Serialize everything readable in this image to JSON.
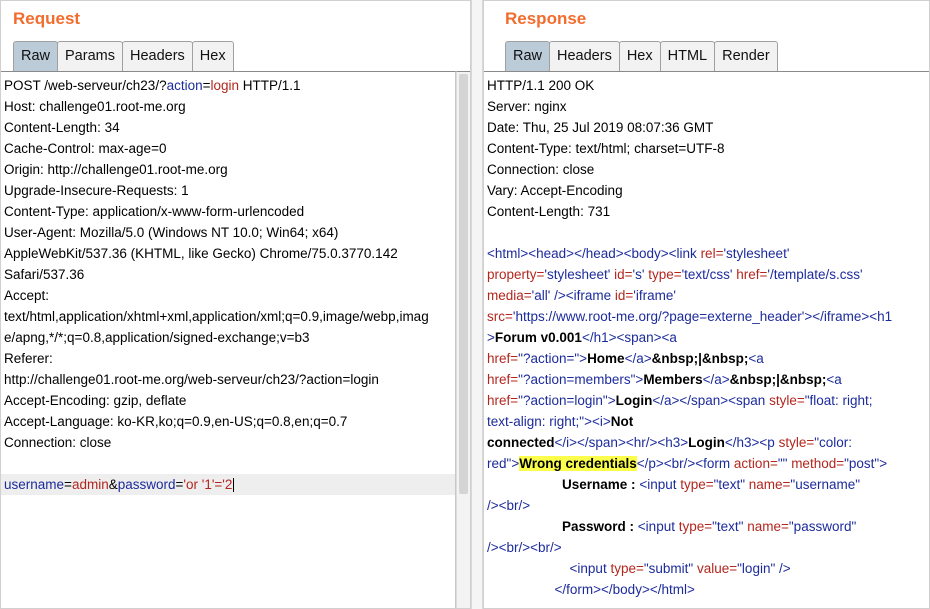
{
  "request": {
    "title": "Request",
    "tabs": [
      "Raw",
      "Params",
      "Headers",
      "Hex"
    ],
    "active_tab": "Raw",
    "request_line": {
      "method_path": "POST /web-serveur/ch23/?",
      "param": "action",
      "eq": "=",
      "value": "login",
      "version": " HTTP/1.1"
    },
    "headers": [
      "Host: challenge01.root-me.org",
      "Content-Length: 34",
      "Cache-Control: max-age=0",
      "Origin: http://challenge01.root-me.org",
      "Upgrade-Insecure-Requests: 1",
      "Content-Type: application/x-www-form-urlencoded",
      "User-Agent: Mozilla/5.0 (Windows NT 10.0; Win64; x64)",
      "AppleWebKit/537.36 (KHTML, like Gecko) Chrome/75.0.3770.142",
      "Safari/537.36",
      "Accept:",
      "text/html,application/xhtml+xml,application/xml;q=0.9,image/webp,imag",
      "e/apng,*/*;q=0.8,application/signed-exchange;v=b3",
      "Referer:",
      "http://challenge01.root-me.org/web-serveur/ch23/?action=login",
      "Accept-Encoding: gzip, deflate",
      "Accept-Language: ko-KR,ko;q=0.9,en-US;q=0.8,en;q=0.7",
      "Connection: close"
    ],
    "body": {
      "k1": "username",
      "v1": "admin",
      "amp": "&",
      "k2": "password",
      "v2": "'or '1'='2"
    }
  },
  "response": {
    "title": "Response",
    "tabs": [
      "Raw",
      "Headers",
      "Hex",
      "HTML",
      "Render"
    ],
    "active_tab": "Raw",
    "headers": [
      "HTTP/1.1 200 OK",
      "Server: nginx",
      "Date: Thu, 25 Jul 2019 08:07:36 GMT",
      "Content-Type: text/html; charset=UTF-8",
      "Connection: close",
      "Vary: Accept-Encoding",
      "Content-Length: 731"
    ],
    "body_lines": [
      [
        [
          "b",
          "<html><head></head><body><link "
        ],
        [
          "r",
          "rel="
        ],
        [
          "b",
          "'stylesheet'"
        ]
      ],
      [
        [
          "r",
          "property="
        ],
        [
          "b",
          "'stylesheet' "
        ],
        [
          "r",
          "id="
        ],
        [
          "b",
          "'s' "
        ],
        [
          "r",
          "type="
        ],
        [
          "b",
          "'text/css' "
        ],
        [
          "r",
          "href="
        ],
        [
          "b",
          "'/template/s.css'"
        ]
      ],
      [
        [
          "r",
          "media="
        ],
        [
          "b",
          "'all' "
        ],
        [
          "b",
          "/><iframe "
        ],
        [
          "r",
          "id="
        ],
        [
          "b",
          "'iframe'"
        ]
      ],
      [
        [
          "r",
          "src="
        ],
        [
          "b",
          "'https://www.root-me.org/?page=externe_header'"
        ],
        [
          "b",
          "></iframe><h1"
        ]
      ],
      [
        [
          "b",
          ">"
        ],
        [
          "kb",
          "Forum v0.001"
        ],
        [
          "b",
          "</h1><span><a"
        ]
      ],
      [
        [
          "r",
          "href="
        ],
        [
          "b",
          "\"?action=\""
        ],
        [
          "b",
          ">"
        ],
        [
          "kb",
          "Home"
        ],
        [
          "b",
          "</a>"
        ],
        [
          "kb",
          "&nbsp;|&nbsp;"
        ],
        [
          "b",
          "<a"
        ]
      ],
      [
        [
          "r",
          "href="
        ],
        [
          "b",
          "\"?action=members\""
        ],
        [
          "b",
          ">"
        ],
        [
          "kb",
          "Members"
        ],
        [
          "b",
          "</a>"
        ],
        [
          "kb",
          "&nbsp;|&nbsp;"
        ],
        [
          "b",
          "<a"
        ]
      ],
      [
        [
          "r",
          "href="
        ],
        [
          "b",
          "\"?action=login\""
        ],
        [
          "b",
          ">"
        ],
        [
          "kb",
          "Login"
        ],
        [
          "b",
          "</a></span><span "
        ],
        [
          "r",
          "style="
        ],
        [
          "b",
          "\"float: right;"
        ]
      ],
      [
        [
          "b",
          "text-align: right;\""
        ],
        [
          "b",
          "><i>"
        ],
        [
          "kb",
          "Not"
        ]
      ],
      [
        [
          "kb",
          "connected"
        ],
        [
          "b",
          "</i></span><hr/><h3>"
        ],
        [
          "kb",
          "Login"
        ],
        [
          "b",
          "</h3><p "
        ],
        [
          "r",
          "style="
        ],
        [
          "b",
          "\"color:"
        ]
      ],
      [
        [
          "b",
          "red\""
        ],
        [
          "hl",
          ">Wrong credentials"
        ],
        [
          "b",
          "</p><br/><form "
        ],
        [
          "r",
          "action="
        ],
        [
          "b",
          "\"\" "
        ],
        [
          "r",
          "method="
        ],
        [
          "b",
          "\"post\">"
        ]
      ],
      [
        [
          "sp",
          "                    "
        ],
        [
          "kb",
          "Username : "
        ],
        [
          "b",
          "<input "
        ],
        [
          "r",
          "type="
        ],
        [
          "b",
          "\"text\" "
        ],
        [
          "r",
          "name="
        ],
        [
          "b",
          "\"username\""
        ]
      ],
      [
        [
          "b",
          "/><br/>"
        ]
      ],
      [
        [
          "sp",
          "                    "
        ],
        [
          "kb",
          "Password : "
        ],
        [
          "b",
          "<input "
        ],
        [
          "r",
          "type="
        ],
        [
          "b",
          "\"text\" "
        ],
        [
          "r",
          "name="
        ],
        [
          "b",
          "\"password\""
        ]
      ],
      [
        [
          "b",
          "/><br/><br/>"
        ]
      ],
      [
        [
          "sp",
          "                      "
        ],
        [
          "b",
          "<input "
        ],
        [
          "r",
          "type="
        ],
        [
          "b",
          "\"submit\" "
        ],
        [
          "r",
          "value="
        ],
        [
          "b",
          "\"login\" />"
        ]
      ],
      [
        [
          "sp",
          "                  "
        ],
        [
          "b",
          "</form></body></html>"
        ]
      ]
    ]
  },
  "colors": {
    "title": "#f26c2e",
    "tab_active": "#bccbd8",
    "tab": "#f2f2f2",
    "syntax_blue": "#1c2b9c",
    "syntax_red": "#b3261e",
    "highlight": "#fbff4b"
  }
}
